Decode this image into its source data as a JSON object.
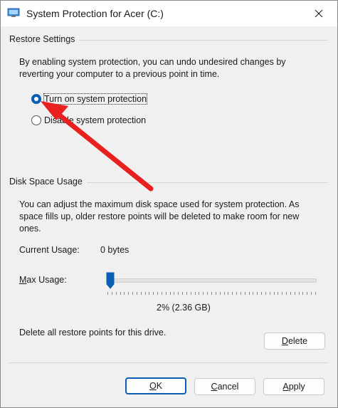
{
  "window": {
    "title": "System Protection for Acer (C:)",
    "close_icon": "close-icon"
  },
  "restore_settings": {
    "section_title": "Restore Settings",
    "description_line1": "By enabling system protection, you can undo undesired changes by",
    "description_line2": "reverting your computer to a previous point in time.",
    "options": [
      {
        "label": "Turn on system protection",
        "checked": true
      },
      {
        "label": "Disable system protection",
        "checked": false
      }
    ]
  },
  "disk_space": {
    "section_title": "Disk Space Usage",
    "description_line1": "You can adjust the maximum disk space used for system protection. As",
    "description_line2": "space fills up, older restore points will be deleted to make room for new",
    "description_line3": "ones.",
    "current_usage_label": "Current Usage:",
    "current_usage_value": "0 bytes",
    "max_usage_label": "Max Usage:",
    "max_usage_percent_value": 2,
    "max_usage_readout": "2% (2.36 GB)",
    "delete_text": "Delete all restore points for this drive.",
    "delete_button": "Delete"
  },
  "buttons": {
    "ok": "OK",
    "cancel": "Cancel",
    "apply": "Apply"
  },
  "annotation": {
    "arrow_color": "#e8211f"
  },
  "colors": {
    "accent": "#0a5fb4"
  }
}
